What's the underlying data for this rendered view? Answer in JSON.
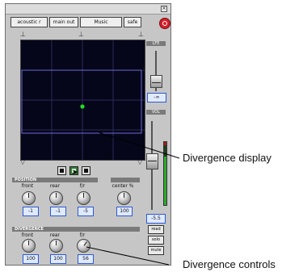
{
  "header": {
    "track_button": "acoustic r",
    "output_button": "main out",
    "music_button": "Music",
    "safe_button": "safe"
  },
  "position": {
    "label": "POSITION",
    "knobs": [
      {
        "label": "front",
        "value": "-1"
      },
      {
        "label": "rear",
        "value": "-1"
      },
      {
        "label": "f/r",
        "value": "-5"
      }
    ],
    "center": {
      "label": "center %",
      "value": "100"
    }
  },
  "divergence": {
    "label": "DIVERGENCE",
    "knobs": [
      {
        "label": "front",
        "value": "100"
      },
      {
        "label": "rear",
        "value": "100"
      },
      {
        "label": "f/r",
        "value": "56"
      }
    ]
  },
  "lfe": {
    "label": "LFE",
    "value": "-∞"
  },
  "vol": {
    "label": "VOL",
    "value": "-5.5"
  },
  "side_buttons": {
    "read": "read",
    "solo": "solo",
    "mute": "mute"
  },
  "callouts": {
    "display": "Divergence display",
    "controls": "Divergence controls"
  },
  "colors": {
    "grid_bg": "#06061a",
    "grid_line": "#2a2a58",
    "divergence_rect": "#6a6ad8",
    "panner_dot": "#22dd22",
    "value_box_bg": "#dfe9ff"
  }
}
